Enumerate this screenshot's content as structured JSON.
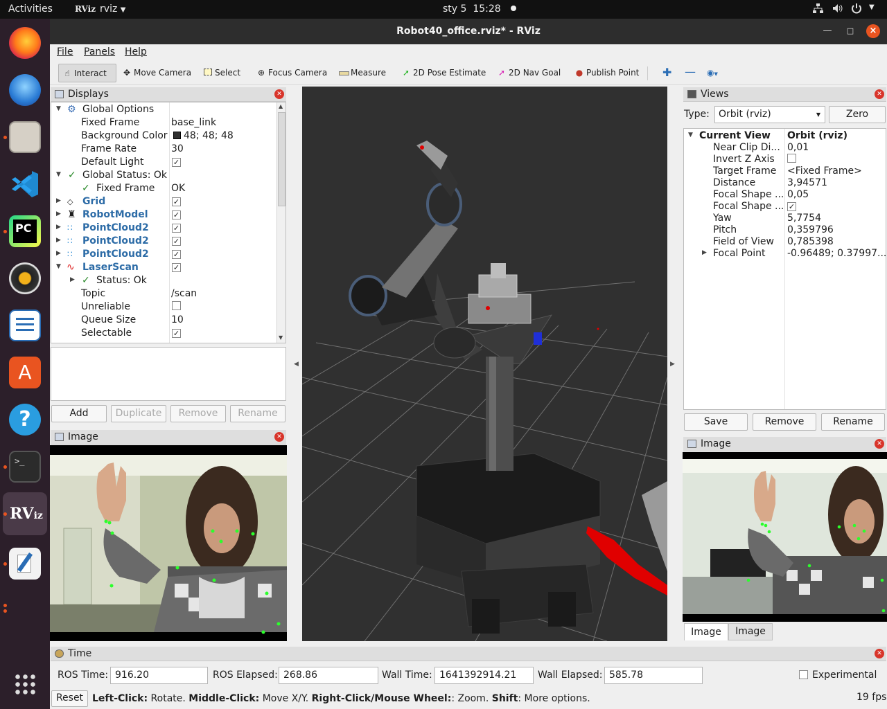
{
  "topbar": {
    "activities": "Activities",
    "app": "rviz",
    "app_logo": "RViz",
    "date": "sty 5",
    "time": "15:28"
  },
  "window": {
    "title": "Robot40_office.rviz* - RViz"
  },
  "menu": [
    "File",
    "Panels",
    "Help"
  ],
  "toolbar": {
    "interact": "Interact",
    "move_camera": "Move Camera",
    "select": "Select",
    "focus_camera": "Focus Camera",
    "measure": "Measure",
    "pose": "2D Pose Estimate",
    "nav": "2D Nav Goal",
    "publish": "Publish Point"
  },
  "displays": {
    "title": "Displays",
    "rows": [
      {
        "k": "Global Options",
        "v": ""
      },
      {
        "k": "Fixed Frame",
        "v": "base_link"
      },
      {
        "k": "Background Color",
        "v": "48; 48; 48"
      },
      {
        "k": "Frame Rate",
        "v": "30"
      },
      {
        "k": "Default Light",
        "v": ""
      },
      {
        "k": "Global Status: Ok",
        "v": ""
      },
      {
        "k": "Fixed Frame",
        "v": "OK"
      },
      {
        "k": "Grid",
        "v": ""
      },
      {
        "k": "RobotModel",
        "v": ""
      },
      {
        "k": "PointCloud2",
        "v": ""
      },
      {
        "k": "PointCloud2",
        "v": ""
      },
      {
        "k": "PointCloud2",
        "v": ""
      },
      {
        "k": "LaserScan",
        "v": ""
      },
      {
        "k": "Status: Ok",
        "v": ""
      },
      {
        "k": "Topic",
        "v": "/scan"
      },
      {
        "k": "Unreliable",
        "v": ""
      },
      {
        "k": "Queue Size",
        "v": "10"
      },
      {
        "k": "Selectable",
        "v": ""
      }
    ],
    "buttons": {
      "add": "Add",
      "duplicate": "Duplicate",
      "remove": "Remove",
      "rename": "Rename"
    }
  },
  "image_left": {
    "title": "Image"
  },
  "views": {
    "title": "Views",
    "type_label": "Type:",
    "type_value": "Orbit (rviz)",
    "zero": "Zero",
    "header_k": "Current View",
    "header_v": "Orbit (rviz)",
    "rows": [
      {
        "k": "Near Clip Di...",
        "v": "0,01"
      },
      {
        "k": "Invert Z Axis",
        "v": ""
      },
      {
        "k": "Target Frame",
        "v": "<Fixed Frame>"
      },
      {
        "k": "Distance",
        "v": "3,94571"
      },
      {
        "k": "Focal Shape ...",
        "v": "0,05"
      },
      {
        "k": "Focal Shape ...",
        "v": ""
      },
      {
        "k": "Yaw",
        "v": "5,7754"
      },
      {
        "k": "Pitch",
        "v": "0,359796"
      },
      {
        "k": "Field of View",
        "v": "0,785398"
      },
      {
        "k": "Focal Point",
        "v": "-0.96489; 0.37997..."
      }
    ],
    "buttons": {
      "save": "Save",
      "remove": "Remove",
      "rename": "Rename"
    }
  },
  "image_right": {
    "title": "Image",
    "tab1": "Image",
    "tab2": "Image"
  },
  "time": {
    "title": "Time",
    "ros_time_label": "ROS Time:",
    "ros_time": "916.20",
    "ros_elapsed_label": "ROS Elapsed:",
    "ros_elapsed": "268.86",
    "wall_time_label": "Wall Time:",
    "wall_time": "1641392914.21",
    "wall_elapsed_label": "Wall Elapsed:",
    "wall_elapsed": "585.78",
    "experimental": "Experimental"
  },
  "status": {
    "reset": "Reset",
    "left_click": "Left-Click:",
    "left_desc": " Rotate. ",
    "middle_click": "Middle-Click:",
    "middle_desc": " Move X/Y. ",
    "right_click": "Right-Click/Mouse Wheel:",
    "right_desc": ": Zoom. ",
    "shift": "Shift",
    "shift_desc": ": More options.",
    "fps": "19 fps"
  },
  "colors": {
    "viewport_bg": "#303030",
    "laser": "#e00000",
    "ok": "#2a8a2a",
    "accent": "#e95420"
  }
}
